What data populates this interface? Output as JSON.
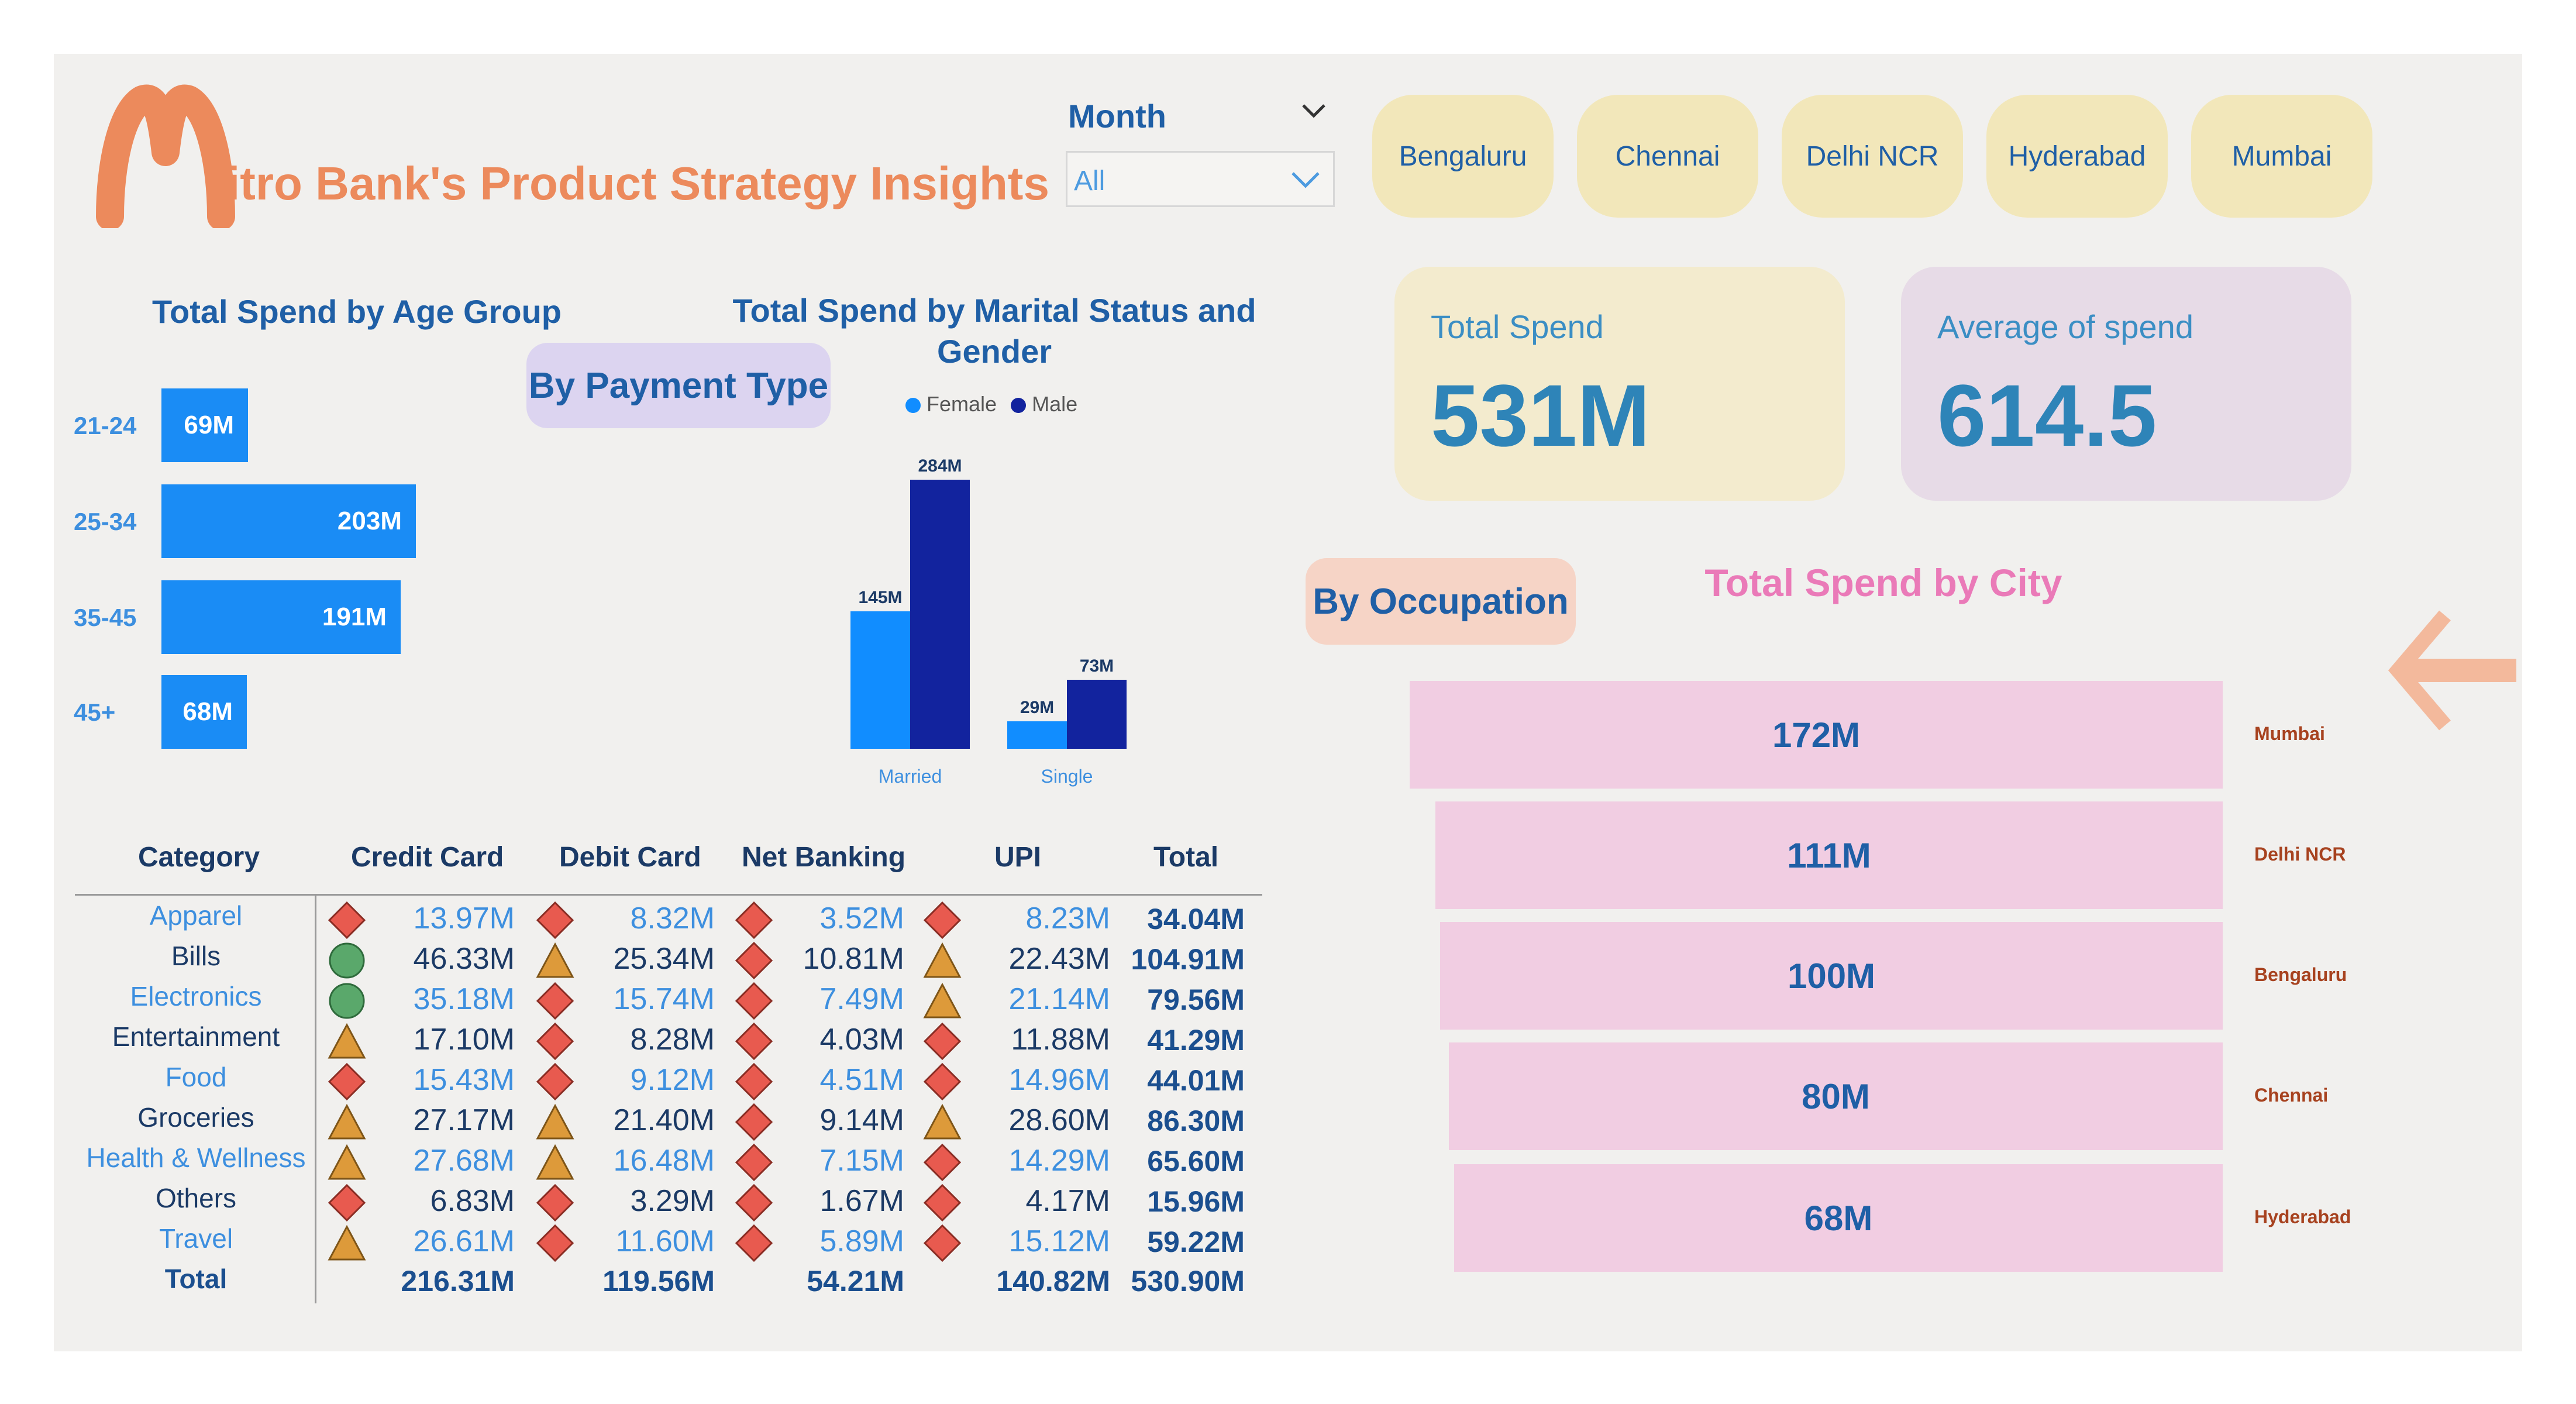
{
  "header": {
    "logo_letter": "M",
    "title_rest": "itro Bank's Product Strategy Insights"
  },
  "filter": {
    "label": "Month",
    "selected": "All"
  },
  "city_buttons": [
    "Bengaluru",
    "Chennai",
    "Delhi NCR",
    "Hyderabad",
    "Mumbai"
  ],
  "kpis": {
    "total_spend": {
      "label": "Total Spend",
      "value": "531M"
    },
    "average_spend": {
      "label": "Average of spend",
      "value": "614.5"
    }
  },
  "nav": {
    "by_payment_type": "By Payment Type",
    "by_occupation": "By Occupation"
  },
  "age_chart": {
    "title": "Total Spend by Age Group",
    "chart_data": {
      "type": "bar",
      "orientation": "horizontal",
      "categories": [
        "21-24",
        "25-34",
        "35-45",
        "45+"
      ],
      "values": [
        69,
        203,
        191,
        68
      ],
      "value_labels": [
        "69M",
        "203M",
        "191M",
        "68M"
      ],
      "unit": "M"
    }
  },
  "marital_chart": {
    "title_line1": "Total Spend by Marital Status and",
    "title_line2": "Gender",
    "chart_data": {
      "type": "bar",
      "categories": [
        "Married",
        "Single"
      ],
      "series": [
        {
          "name": "Female",
          "values": [
            145,
            29
          ],
          "labels": [
            "145M",
            "29M"
          ],
          "color": "#118dff"
        },
        {
          "name": "Male",
          "values": [
            284,
            73
          ],
          "labels": [
            "284M",
            "73M"
          ],
          "color": "#12239e"
        }
      ],
      "unit": "M"
    }
  },
  "city_chart": {
    "title": "Total Spend by City",
    "chart_data": {
      "type": "bar",
      "orientation": "horizontal",
      "categories": [
        "Mumbai",
        "Delhi NCR",
        "Bengaluru",
        "Chennai",
        "Hyderabad"
      ],
      "values": [
        172,
        111,
        100,
        80,
        68
      ],
      "value_labels": [
        "172M",
        "111M",
        "100M",
        "80M",
        "68M"
      ],
      "unit": "M"
    }
  },
  "table": {
    "headers": [
      "Category",
      "Credit Card",
      "Debit Card",
      "Net Banking",
      "UPI",
      "Total"
    ],
    "rows": [
      {
        "category": "Apparel",
        "cells": [
          "13.97M",
          "8.32M",
          "3.52M",
          "8.23M"
        ],
        "icons": [
          "diamond",
          "diamond",
          "diamond",
          "diamond"
        ],
        "total": "34.04M"
      },
      {
        "category": "Bills",
        "cells": [
          "46.33M",
          "25.34M",
          "10.81M",
          "22.43M"
        ],
        "icons": [
          "circle",
          "triangle",
          "diamond",
          "triangle"
        ],
        "total": "104.91M"
      },
      {
        "category": "Electronics",
        "cells": [
          "35.18M",
          "15.74M",
          "7.49M",
          "21.14M"
        ],
        "icons": [
          "circle",
          "diamond",
          "diamond",
          "triangle"
        ],
        "total": "79.56M"
      },
      {
        "category": "Entertainment",
        "cells": [
          "17.10M",
          "8.28M",
          "4.03M",
          "11.88M"
        ],
        "icons": [
          "triangle",
          "diamond",
          "diamond",
          "diamond"
        ],
        "total": "41.29M"
      },
      {
        "category": "Food",
        "cells": [
          "15.43M",
          "9.12M",
          "4.51M",
          "14.96M"
        ],
        "icons": [
          "diamond",
          "diamond",
          "diamond",
          "diamond"
        ],
        "total": "44.01M"
      },
      {
        "category": "Groceries",
        "cells": [
          "27.17M",
          "21.40M",
          "9.14M",
          "28.60M"
        ],
        "icons": [
          "triangle",
          "triangle",
          "diamond",
          "triangle"
        ],
        "total": "86.30M"
      },
      {
        "category": "Health & Wellness",
        "cells": [
          "27.68M",
          "16.48M",
          "7.15M",
          "14.29M"
        ],
        "icons": [
          "triangle",
          "triangle",
          "diamond",
          "diamond"
        ],
        "total": "65.60M"
      },
      {
        "category": "Others",
        "cells": [
          "6.83M",
          "3.29M",
          "1.67M",
          "4.17M"
        ],
        "icons": [
          "diamond",
          "diamond",
          "diamond",
          "diamond"
        ],
        "total": "15.96M"
      },
      {
        "category": "Travel",
        "cells": [
          "26.61M",
          "11.60M",
          "5.89M",
          "15.12M"
        ],
        "icons": [
          "triangle",
          "diamond",
          "diamond",
          "diamond"
        ],
        "total": "59.22M"
      }
    ],
    "total_row": {
      "label": "Total",
      "cells": [
        "216.31M",
        "119.56M",
        "54.21M",
        "140.82M"
      ],
      "total": "530.90M"
    }
  },
  "colors": {
    "title_orange": "#ec8a5c",
    "accent_blue": "#1f5fa6",
    "bar_blue": "#1a8cf5",
    "city_pink": "#f1cde2",
    "diamond_red": "#e85a4f",
    "triangle_orange": "#dd9a3a",
    "circle_green": "#5aa86b"
  }
}
